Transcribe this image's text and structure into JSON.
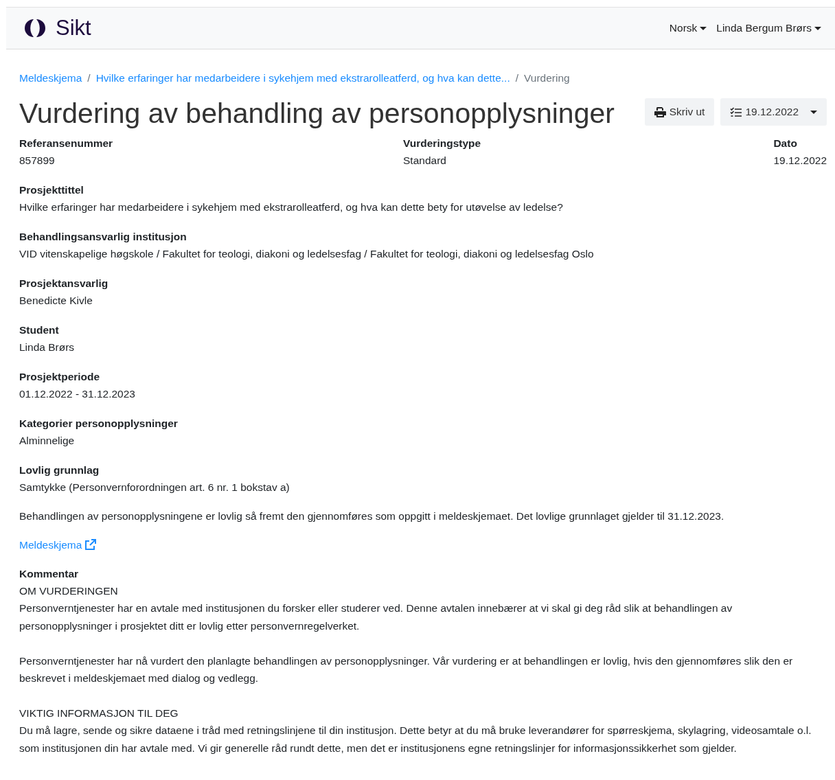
{
  "navbar": {
    "brand": "Sikt",
    "menus": [
      {
        "label": "Norsk"
      },
      {
        "label": "Linda Bergum Brørs"
      }
    ]
  },
  "breadcrumb_separator": "/",
  "breadcrumb": [
    {
      "label": "Meldeskjema",
      "kind": "link"
    },
    {
      "label": "Hvilke erfaringer har medarbeidere i sykehjem med ekstrarolleatferd, og hva kan dette...",
      "kind": "link"
    },
    {
      "label": "Vurdering",
      "kind": "current"
    }
  ],
  "title": "Vurdering av behandling av personopplysninger",
  "actions": {
    "print": "Skriv ut",
    "version": "19.12.2022"
  },
  "summary": [
    {
      "label": "Referansenummer",
      "value": "857899"
    },
    {
      "label": "Vurderingstype",
      "value": "Standard"
    },
    {
      "label": "Dato",
      "value": "19.12.2022"
    }
  ],
  "fields": [
    {
      "label": "Prosjekttittel",
      "value": "Hvilke erfaringer har medarbeidere i sykehjem med ekstrarolleatferd, og hva kan dette bety for utøvelse av ledelse?"
    },
    {
      "label": "Behandlingsansvarlig institusjon",
      "value": "VID vitenskapelige høgskole / Fakultet for teologi, diakoni og ledelsesfag / Fakultet for teologi, diakoni og ledelsesfag Oslo"
    },
    {
      "label": "Prosjektansvarlig",
      "value": "Benedicte Kivle"
    },
    {
      "label": "Student",
      "value": "Linda Brørs"
    },
    {
      "label": "Prosjektperiode",
      "value": "01.12.2022 - 31.12.2023"
    },
    {
      "label": "Kategorier personopplysninger",
      "value": "Alminnelige"
    },
    {
      "label": "Lovlig grunnlag",
      "value": "Samtykke (Personvernforordningen art. 6 nr. 1 bokstav a)"
    }
  ],
  "legal_note": "Behandlingen av personopplysningene er lovlig så fremt den gjennomføres som oppgitt i meldeskjemaet. Det lovlige grunnlaget gjelder til 31.12.2023.",
  "form_link": "Meldeskjema",
  "comment": {
    "label": "Kommentar",
    "sections": [
      {
        "heading": "OM VURDERINGEN",
        "paragraphs": [
          "Personverntjenester har en avtale med institusjonen du forsker eller studerer ved. Denne avtalen innebærer at vi skal gi deg råd slik at behandlingen av personopplysninger i prosjektet ditt er lovlig etter personvernregelverket.",
          "Personverntjenester har nå vurdert den planlagte behandlingen av personopplysninger. Vår vurdering er at behandlingen er lovlig, hvis den gjennomføres slik den er beskrevet i meldeskjemaet med dialog og vedlegg."
        ]
      },
      {
        "heading": "VIKTIG INFORMASJON TIL DEG",
        "paragraphs": [
          "Du må lagre, sende og sikre dataene i tråd med retningslinjene til din institusjon. Dette betyr at du må bruke leverandører for spørreskjema, skylagring, videosamtale o.l. som institusjonen din har avtale med. Vi gir generelle råd rundt dette, men det er institusjonens egne retningslinjer for informasjonssikkerhet som gjelder."
        ]
      }
    ]
  }
}
